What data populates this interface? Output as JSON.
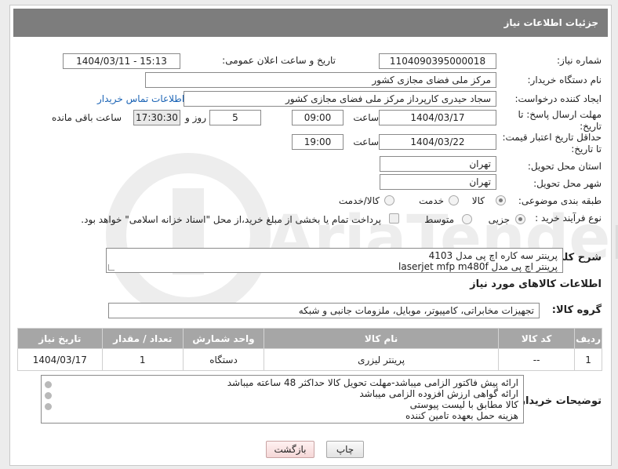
{
  "header": {
    "title": "جزئیات اطلاعات نیاز"
  },
  "fields": {
    "need_number_label": "شماره نیاز:",
    "need_number": "1104090395000018",
    "announce_label": "تاریخ و ساعت اعلان عمومی:",
    "announce_value": "1404/03/11 - 15:13",
    "buyer_org_label": "نام دستگاه خریدار:",
    "buyer_org": "مرکز ملی فضای مجازی کشور",
    "creator_label": "ایجاد کننده درخواست:",
    "creator": "سجاد حیدری کارپرداز مرکز ملی فضای مجازی کشور",
    "contact_link": "اطلاعات تماس خریدار",
    "reply_deadline_label_1": "مهلت ارسال پاسخ: تا",
    "reply_deadline_label_2": "تاریخ:",
    "reply_date": "1404/03/17",
    "time_label": "ساعت",
    "reply_time": "09:00",
    "days_value": "5",
    "days_label": "روز و",
    "remaining_time": "17:30:30",
    "remaining_label": "ساعت باقی مانده",
    "validity_label_1": "حداقل تاریخ اعتبار قیمت:",
    "validity_label_2": "تا تاریخ:",
    "validity_date": "1404/03/22",
    "validity_time": "19:00",
    "province_label": "استان محل تحویل:",
    "province": "تهران",
    "city_label": "شهر محل تحویل:",
    "city": "تهران",
    "category_label": "طبقه بندی موضوعی:",
    "category_options": [
      "کالا",
      "خدمت",
      "کالا/خدمت"
    ],
    "category_selected": "کالا",
    "process_label": "نوع فرآیند خرید :",
    "process_options": [
      "جزیی",
      "متوسط"
    ],
    "process_selected": "جزیی",
    "payment_note": "پرداخت تمام یا بخشی از مبلغ خرید،از محل \"اسناد خزانه اسلامی\" خواهد بود.",
    "description_label": "شرح کلی نیاز:",
    "description_line1": "پرینتر سه کاره اچ پی مدل 4103",
    "description_line2": "پرینتر اچ پی مدل  laserjet mfp m480f",
    "goods_info_title": "اطلاعات کالاهای مورد نیاز",
    "goods_group_label": "گروه کالا:",
    "goods_group": "تجهیزات مخابراتی، کامپیوتر، موبایل، ملزومات جانبی و شبکه",
    "buyer_notes_label": "توضیحات خریدار:",
    "buyer_notes": [
      "ارائه پیش فاکتور الزامی میباشد-مهلت تحویل کالا حداکثر 48 ساعته میباشد",
      "ارائه گواهی ارزش افزوده الزامی میباشد",
      "کالا مطابق با لیست پیوستی",
      "هزینه حمل بعهده تامین کننده"
    ]
  },
  "table": {
    "headers": [
      "ردیف",
      "کد کالا",
      "نام کالا",
      "واحد شمارش",
      "تعداد / مقدار",
      "تاریخ نیاز"
    ],
    "rows": [
      [
        "1",
        "--",
        "پرینتر لیزری",
        "دستگاه",
        "1",
        "1404/03/17"
      ]
    ]
  },
  "buttons": {
    "print": "چاپ",
    "back": "بازگشت"
  },
  "watermark": {
    "text": "AriaTender.neT"
  },
  "colors": {
    "header_bg": "#7d7d7d",
    "table_header_bg": "#a6a6a6",
    "link": "#1a63b5"
  }
}
